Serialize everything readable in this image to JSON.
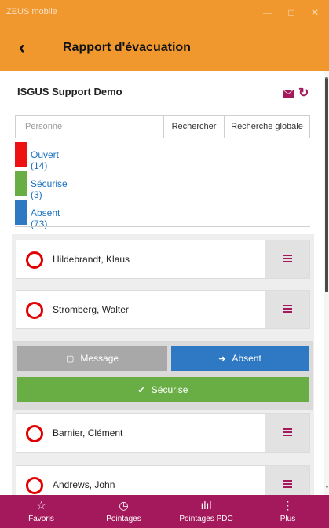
{
  "window": {
    "title": "ZEUS mobile",
    "minimize": "—",
    "maximize": "□",
    "close": "✕"
  },
  "header": {
    "back_icon": "‹",
    "title": "Rapport d'évacuation"
  },
  "company": {
    "name": "ISGUS Support Demo",
    "refresh_icon": "↻"
  },
  "search": {
    "placeholder": "Personne",
    "value": "",
    "search_button": "Rechercher",
    "global_button": "Recherche globale"
  },
  "filters": [
    {
      "label": "Ouvert (14)",
      "color": "#ee1111"
    },
    {
      "label": "Sécurise (3)",
      "color": "#69ae45"
    },
    {
      "label": "Absent (73)",
      "color": "#2f78c4"
    }
  ],
  "persons": [
    {
      "name": "Hildebrandt, Klaus"
    },
    {
      "name": "Stromberg, Walter"
    },
    {
      "name": "Barnier, Clément"
    },
    {
      "name": "Andrews, John"
    }
  ],
  "actions": {
    "message": "Message",
    "absent": "Absent",
    "securise": "Sécurise"
  },
  "nav": [
    {
      "label": "Favoris",
      "icon": "☆"
    },
    {
      "label": "Pointages",
      "icon": "◷"
    },
    {
      "label": "Pointages PDC",
      "icon": "ılıl"
    },
    {
      "label": "Plus",
      "icon": "⋮"
    }
  ],
  "colors": {
    "accent_orange": "#f0982d",
    "brand_magenta": "#a3195b",
    "status_red": "#e00000"
  }
}
